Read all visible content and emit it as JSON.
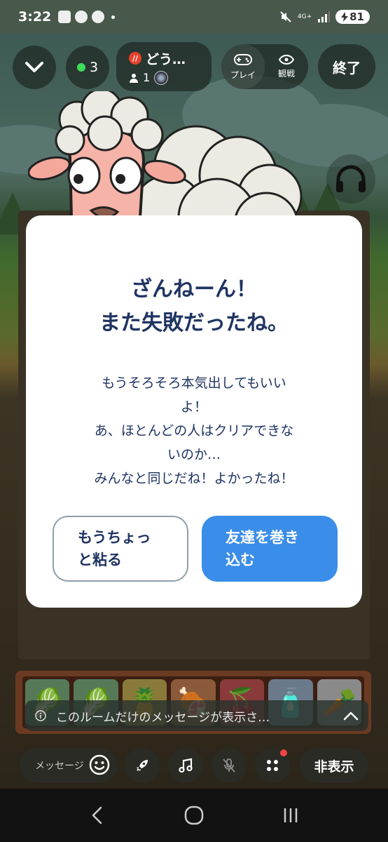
{
  "status_bar": {
    "time": "3:22",
    "network": "4G+",
    "battery": "81"
  },
  "top_controls": {
    "online_count": "3",
    "room_title": "どう…",
    "room_badge": "//",
    "room_user_count": "1",
    "mode_play_label": "プレイ",
    "mode_watch_label": "観戦",
    "end_label": "終了"
  },
  "modal": {
    "title_lines": [
      "ざんねーん！",
      "また失敗だったね。"
    ],
    "body_lines": [
      "もうそろそろ本気出してもいい",
      "よ！",
      "あ、ほとんどの人はクリアできな",
      "いのか…",
      "みんなと同じだね！よかったね！"
    ],
    "stay_button_label": "もうちょっ と粘る",
    "invite_button_label": "友達を巻き 込む"
  },
  "notice": {
    "text": "このルームだけのメッセージが表示さ…"
  },
  "toolbar": {
    "message_placeholder": "メッセージ",
    "hide_label": "非表示"
  },
  "icons": {
    "collapse": "chevron-down-icon",
    "headphone": "headphone-icon",
    "emoji": "emoji-icon",
    "rocket": "rocket-icon",
    "music": "music-icon",
    "mic_off": "mic-off-icon",
    "apps": "apps-icon"
  },
  "colors": {
    "title_text": "#1f3462",
    "primary_button": "#3a8de8",
    "online_dot": "#3ddc5a"
  }
}
